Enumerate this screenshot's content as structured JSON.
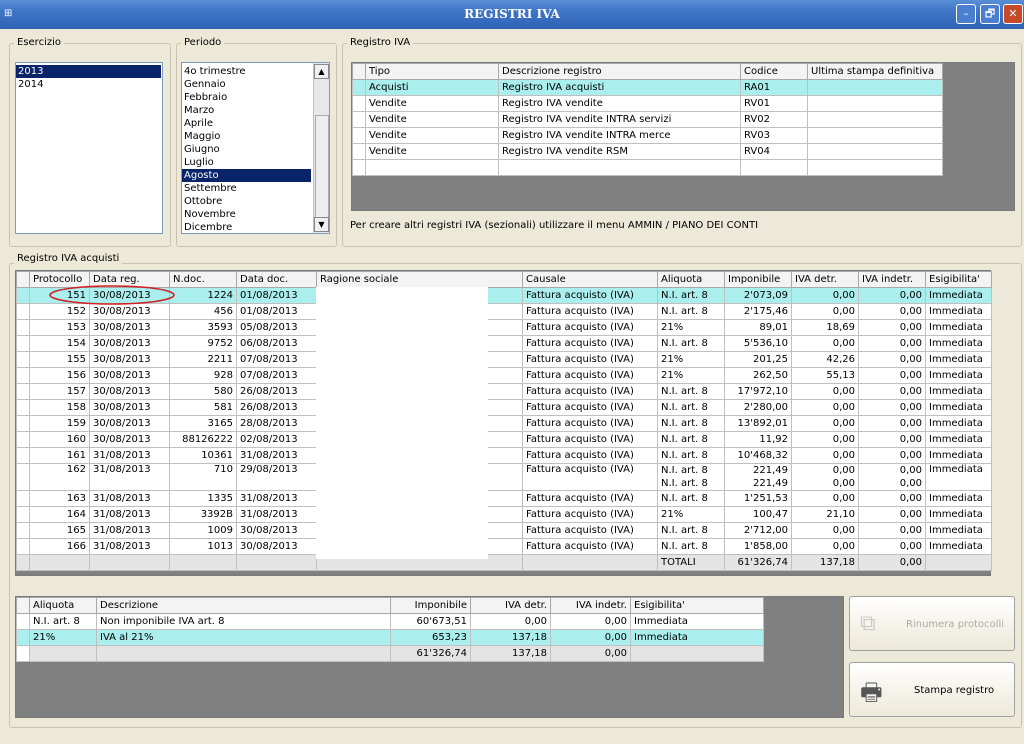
{
  "window": {
    "title": "REGISTRI IVA",
    "minimize": "–",
    "restore": "🗗",
    "close": "✕"
  },
  "esercizio": {
    "label": "Esercizio",
    "items": [
      "2013",
      "2014"
    ],
    "selected": 0
  },
  "periodo": {
    "label": "Periodo",
    "items": [
      "4o trimestre",
      "Gennaio",
      "Febbraio",
      "Marzo",
      "Aprile",
      "Maggio",
      "Giugno",
      "Luglio",
      "Agosto",
      "Settembre",
      "Ottobre",
      "Novembre",
      "Dicembre"
    ],
    "selected": 8
  },
  "registro": {
    "label": "Registro IVA",
    "columns": [
      "Tipo",
      "Descrizione registro",
      "Codice",
      "Ultima stampa definitiva"
    ],
    "rows": [
      [
        "Acquisti",
        "Registro IVA acquisti",
        "RA01",
        ""
      ],
      [
        "Vendite",
        "Registro IVA vendite",
        "RV01",
        ""
      ],
      [
        "Vendite",
        "Registro IVA vendite INTRA servizi",
        "RV02",
        ""
      ],
      [
        "Vendite",
        "Registro IVA vendite INTRA merce",
        "RV03",
        ""
      ],
      [
        "Vendite",
        "Registro IVA vendite RSM",
        "RV04",
        ""
      ]
    ],
    "note": "Per creare altri registri IVA (sezionali) utilizzare il menu AMMIN / PIANO DEI CONTI"
  },
  "acquisti": {
    "label": "Registro IVA acquisti",
    "columns": [
      "Protocollo",
      "Data reg.",
      "N.doc.",
      "Data doc.",
      "Ragione sociale",
      "Causale",
      "Aliquota",
      "Imponibile",
      "IVA detr.",
      "IVA indetr.",
      "Esigibilita'"
    ],
    "rows": [
      [
        "151",
        "30/08/2013",
        "1224",
        "01/08/2013",
        "",
        "Fattura acquisto (IVA)",
        "N.I. art. 8",
        "2'073,09",
        "0,00",
        "0,00",
        "Immediata"
      ],
      [
        "152",
        "30/08/2013",
        "456",
        "01/08/2013",
        "",
        "Fattura acquisto (IVA)",
        "N.I. art. 8",
        "2'175,46",
        "0,00",
        "0,00",
        "Immediata"
      ],
      [
        "153",
        "30/08/2013",
        "3593",
        "05/08/2013",
        "",
        "Fattura acquisto (IVA)",
        "21%",
        "89,01",
        "18,69",
        "0,00",
        "Immediata"
      ],
      [
        "154",
        "30/08/2013",
        "9752",
        "06/08/2013",
        "",
        "Fattura acquisto (IVA)",
        "N.I. art. 8",
        "5'536,10",
        "0,00",
        "0,00",
        "Immediata"
      ],
      [
        "155",
        "30/08/2013",
        "2211",
        "07/08/2013",
        "",
        "Fattura acquisto (IVA)",
        "21%",
        "201,25",
        "42,26",
        "0,00",
        "Immediata"
      ],
      [
        "156",
        "30/08/2013",
        "928",
        "07/08/2013",
        "",
        "Fattura acquisto (IVA)",
        "21%",
        "262,50",
        "55,13",
        "0,00",
        "Immediata"
      ],
      [
        "157",
        "30/08/2013",
        "580",
        "26/08/2013",
        "",
        "Fattura acquisto (IVA)",
        "N.I. art. 8",
        "17'972,10",
        "0,00",
        "0,00",
        "Immediata"
      ],
      [
        "158",
        "30/08/2013",
        "581",
        "26/08/2013",
        "",
        "Fattura acquisto (IVA)",
        "N.I. art. 8",
        "2'280,00",
        "0,00",
        "0,00",
        "Immediata"
      ],
      [
        "159",
        "30/08/2013",
        "3165",
        "28/08/2013",
        "",
        "Fattura acquisto (IVA)",
        "N.I. art. 8",
        "13'892,01",
        "0,00",
        "0,00",
        "Immediata"
      ],
      [
        "160",
        "30/08/2013",
        "88126222",
        "02/08/2013",
        "",
        "Fattura acquisto (IVA)",
        "N.I. art. 8",
        "11,92",
        "0,00",
        "0,00",
        "Immediata"
      ],
      [
        "161",
        "31/08/2013",
        "10361",
        "31/08/2013",
        "",
        "Fattura acquisto (IVA)",
        "N.I. art. 8",
        "10'468,32",
        "0,00",
        "0,00",
        "Immediata"
      ],
      [
        "162",
        "31/08/2013",
        "710",
        "29/08/2013",
        "",
        "Fattura acquisto (IVA)",
        "N.I. art. 8\nN.I. art. 8",
        "221,49\n221,49",
        "0,00\n0,00",
        "0,00\n0,00",
        "Immediata"
      ],
      [
        "163",
        "31/08/2013",
        "1335",
        "31/08/2013",
        "",
        "Fattura acquisto (IVA)",
        "N.I. art. 8",
        "1'251,53",
        "0,00",
        "0,00",
        "Immediata"
      ],
      [
        "164",
        "31/08/2013",
        "3392B",
        "31/08/2013",
        "",
        "Fattura acquisto (IVA)",
        "21%",
        "100,47",
        "21,10",
        "0,00",
        "Immediata"
      ],
      [
        "165",
        "31/08/2013",
        "1009",
        "30/08/2013",
        "",
        "Fattura acquisto (IVA)",
        "N.I. art. 8",
        "2'712,00",
        "0,00",
        "0,00",
        "Immediata"
      ],
      [
        "166",
        "31/08/2013",
        "1013",
        "30/08/2013",
        "",
        "Fattura acquisto (IVA)",
        "N.I. art. 8",
        "1'858,00",
        "0,00",
        "0,00",
        "Immediata"
      ]
    ],
    "totals": {
      "label": "TOTALI",
      "imponibile": "61'326,74",
      "iva_detr": "137,18",
      "iva_indetr": "0,00"
    }
  },
  "riepilogo": {
    "columns": [
      "Aliquota",
      "Descrizione",
      "Imponibile",
      "IVA detr.",
      "IVA indetr.",
      "Esigibilita'"
    ],
    "rows": [
      [
        "N.I. art. 8",
        "Non imponibile IVA art. 8",
        "60'673,51",
        "0,00",
        "0,00",
        "Immediata"
      ],
      [
        "21%",
        "IVA al 21%",
        "653,23",
        "137,18",
        "0,00",
        "Immediata"
      ],
      [
        "",
        "",
        "61'326,74",
        "137,18",
        "0,00",
        ""
      ]
    ]
  },
  "buttons": {
    "rinumera": "Rinumera protocolli",
    "stampa": "Stampa registro"
  },
  "colors": {
    "titlebar": "#3f74c6",
    "highlight_row": "#aaeeee",
    "selection": "#0a246a",
    "annotation_circle": "#d02020"
  }
}
